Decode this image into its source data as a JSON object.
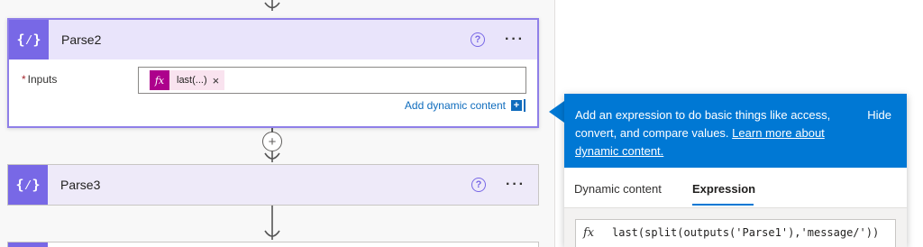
{
  "cards": [
    {
      "title": "Parse2",
      "icon": "expression-braces-icon"
    },
    {
      "title": "Parse3",
      "icon": "expression-braces-icon"
    }
  ],
  "card_icon_glyph": "{⁄}",
  "help_glyph": "?",
  "more_glyph": "···",
  "parse2": {
    "inputs_label": "Inputs",
    "required_mark": "*",
    "token": {
      "fx": "fx",
      "label": "last(...)",
      "remove": "×"
    },
    "add_dynamic_label": "Add dynamic content",
    "add_dynamic_plus": "+"
  },
  "add_step_glyph": "+",
  "popup": {
    "banner_text": "Add an expression to do basic things like access, convert, and compare values.",
    "banner_link": "Learn more about dynamic content.",
    "hide_label": "Hide",
    "tabs": [
      "Dynamic content",
      "Expression"
    ],
    "active_tab": "Expression",
    "expression_fx": "fx",
    "expression_value": "last(split(outputs('Parse1'),'message/'))"
  },
  "colors": {
    "action_purple": "#7868e6",
    "selected_border": "#8f7fe8",
    "token_magenta": "#ad008c",
    "link_blue": "#0f6cbd",
    "banner_blue": "#0078d4"
  }
}
